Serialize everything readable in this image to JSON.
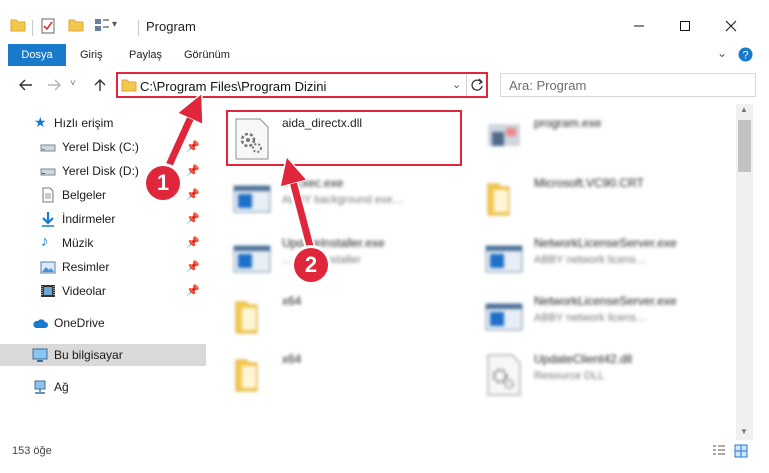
{
  "window": {
    "title": "Program"
  },
  "ribbon": {
    "tabs": [
      "Dosya",
      "Giriş",
      "Paylaş",
      "Görünüm"
    ]
  },
  "address": {
    "path": "C:\\Program Files\\Program Dizini"
  },
  "search": {
    "placeholder": "Ara: Program"
  },
  "sidebar": {
    "quick_access": "Hızlı erişim",
    "items": [
      {
        "label": "Yerel Disk (C:)",
        "icon": "drive-icon",
        "pinned": true
      },
      {
        "label": "Yerel Disk (D:)",
        "icon": "drive-icon",
        "pinned": true
      },
      {
        "label": "Belgeler",
        "icon": "documents-icon",
        "pinned": true
      },
      {
        "label": "İndirmeler",
        "icon": "download-icon",
        "pinned": true
      },
      {
        "label": "Müzik",
        "icon": "music-icon",
        "pinned": true
      },
      {
        "label": "Resimler",
        "icon": "pictures-icon",
        "pinned": true
      },
      {
        "label": "Videolar",
        "icon": "videos-icon",
        "pinned": true
      }
    ],
    "onedrive": "OneDrive",
    "this_pc": "Bu bilgisayar",
    "network": "Ağ",
    "pin_glyph": "📌"
  },
  "files": [
    {
      "name": "aida_directx.dll",
      "desc": "",
      "icon": "dll-gear-icon"
    },
    {
      "name": "program.exe",
      "desc": "",
      "icon": "exe-icon"
    },
    {
      "name": "…Exec.exe",
      "desc": "ABBY background exe…",
      "icon": "app-window-icon"
    },
    {
      "name": "Microsoft.VC90.CRT",
      "desc": "",
      "icon": "folder-icon"
    },
    {
      "name": "UpdateInstaller.exe",
      "desc": "…dates installer",
      "icon": "app-window-icon"
    },
    {
      "name": "NetworkLicenseServer.exe",
      "desc": "ABBY network licens…",
      "icon": "app-window-icon"
    },
    {
      "name": "x64",
      "desc": "",
      "icon": "folder-icon"
    },
    {
      "name": "NetworkLicenseServer.exe",
      "desc": "ABBY network licens…",
      "icon": "app-window-icon"
    },
    {
      "name": "x64",
      "desc": "",
      "icon": "folder-icon"
    },
    {
      "name": "UpdateClient42.dll",
      "desc": "Resource DLL",
      "icon": "dll-gear-icon"
    }
  ],
  "status": {
    "count": "153 öğe"
  },
  "callouts": [
    "1",
    "2"
  ],
  "colors": {
    "accent": "#1979ca",
    "highlight": "#e0263a",
    "folder": "#f3c94d"
  }
}
